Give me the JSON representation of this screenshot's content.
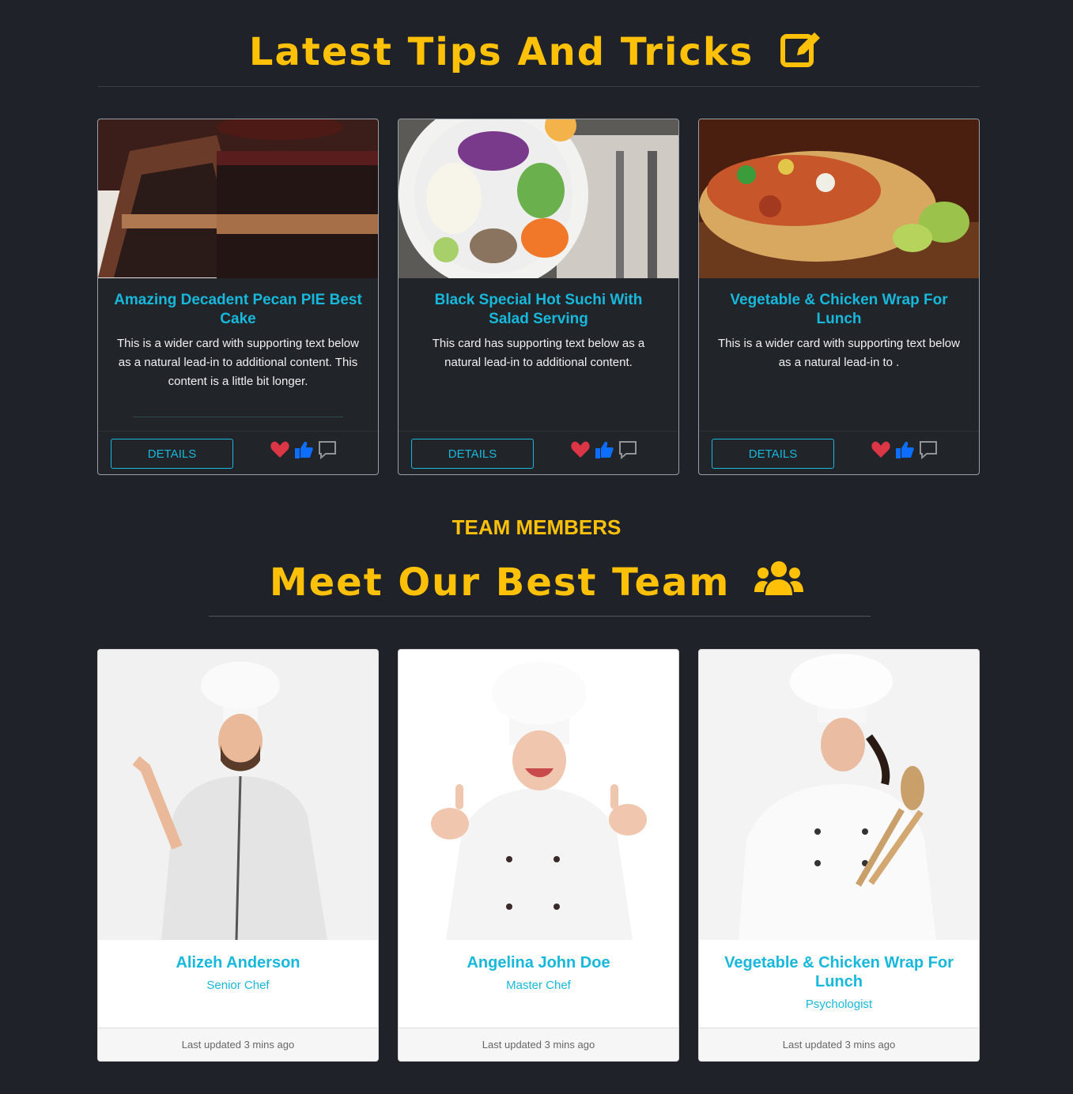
{
  "tips": {
    "heading": "Latest Tips And Tricks",
    "heading_icon": "edit-icon",
    "cards": [
      {
        "title": "Amazing Decadent Pecan PIE Best Cake",
        "text": "This is a wider card with supporting text below as a natural lead-in to additional content. This content is a little bit longer.",
        "button": "DETAILS"
      },
      {
        "title": "Black Special Hot Suchi With Salad Serving",
        "text": "This card has supporting text below as a natural lead-in to additional content.",
        "button": "DETAILS"
      },
      {
        "title": "Vegetable & Chicken Wrap For Lunch",
        "text": "This is a wider card with supporting text below as a natural lead-in to .",
        "button": "DETAILS"
      }
    ]
  },
  "team": {
    "eyebrow": "TEAM MEMBERS",
    "heading": "Meet Our Best Team",
    "heading_icon": "users-icon",
    "members": [
      {
        "name": "Alizeh Anderson",
        "role": "Senior Chef",
        "updated": "Last updated 3 mins ago"
      },
      {
        "name": "Angelina John Doe",
        "role": "Master Chef",
        "updated": "Last updated 3 mins ago"
      },
      {
        "name": "Vegetable & Chicken Wrap For Lunch",
        "role": "Psychologist",
        "updated": "Last updated 3 mins ago"
      }
    ]
  },
  "colors": {
    "accent": "#ffc107",
    "link": "#17b8dc",
    "background": "#1f2329",
    "heart": "#dc3545",
    "like": "#0d6efd"
  }
}
